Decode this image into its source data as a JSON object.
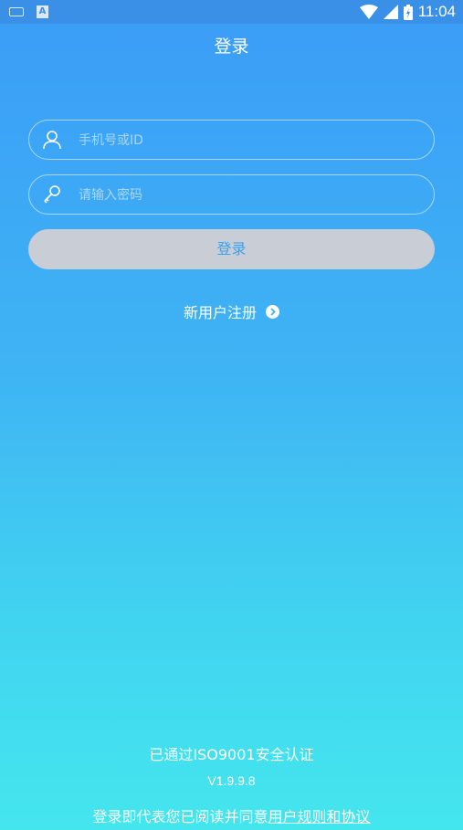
{
  "status_bar": {
    "time": "11:04",
    "notification_icon": "A"
  },
  "header": {
    "title": "登录"
  },
  "form": {
    "account_placeholder": "手机号或ID",
    "password_placeholder": "请输入密码",
    "login_label": "登录"
  },
  "register": {
    "label": "新用户注册"
  },
  "footer": {
    "certification": "已通过ISO9001安全认证",
    "version": "V1.9.9.8",
    "agreement_prefix": "登录即代表您已阅读并同意",
    "agreement_link": "用户规则和协议"
  },
  "colors": {
    "gradient_top": "#3b9cf7",
    "gradient_bottom": "#44e6ee",
    "button_bg": "#c9ced6",
    "button_text": "#39a1f3"
  }
}
